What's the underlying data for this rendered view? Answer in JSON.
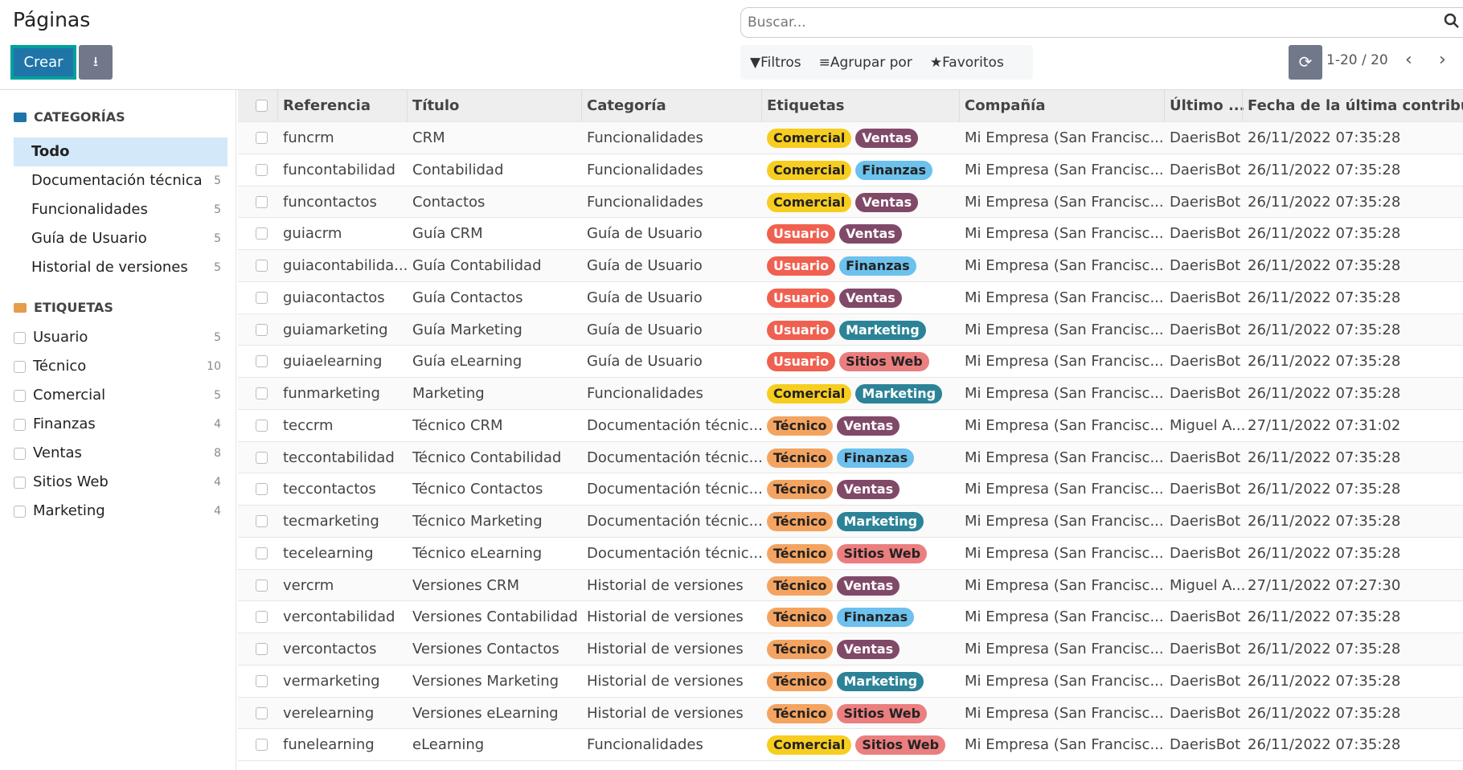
{
  "title": "Páginas",
  "search": {
    "placeholder": "Buscar..."
  },
  "toolbar": {
    "create_label": "Crear",
    "filters": "Filtros",
    "group_by": "Agrupar por",
    "favorites": "Favoritos",
    "pager": "1-20 / 20"
  },
  "sidebar": {
    "categories_title": "CATEGORÍAS",
    "categories": [
      {
        "label": "Todo",
        "count": null
      },
      {
        "label": "Documentación técnica",
        "count": "5"
      },
      {
        "label": "Funcionalidades",
        "count": "5"
      },
      {
        "label": "Guía de Usuario",
        "count": "5"
      },
      {
        "label": "Historial de versiones",
        "count": "5"
      }
    ],
    "tags_title": "ETIQUETAS",
    "tags": [
      {
        "label": "Usuario",
        "count": "5"
      },
      {
        "label": "Técnico",
        "count": "10"
      },
      {
        "label": "Comercial",
        "count": "5"
      },
      {
        "label": "Finanzas",
        "count": "4"
      },
      {
        "label": "Ventas",
        "count": "8"
      },
      {
        "label": "Sitios Web",
        "count": "4"
      },
      {
        "label": "Marketing",
        "count": "4"
      }
    ]
  },
  "colors": {
    "Comercial": [
      "#f7cd1f",
      "#222"
    ],
    "Ventas": [
      "#814968",
      "#fff"
    ],
    "Finanzas": [
      "#6cc1ed",
      "#222"
    ],
    "Usuario": [
      "#f06050",
      "#fff"
    ],
    "Técnico": [
      "#f4a460",
      "#222"
    ],
    "Marketing": [
      "#2c8397",
      "#fff"
    ],
    "Sitios Web": [
      "#eb7e7f",
      "#222"
    ],
    "categories_folder": "#1f75a8",
    "tags_folder": "#e59d4c"
  },
  "table": {
    "columns": [
      "Referencia",
      "Título",
      "Categoría",
      "Etiquetas",
      "Compañía",
      "Último ...",
      "Fecha de la última contribución"
    ],
    "rows": [
      [
        "funcrm",
        "CRM",
        "Funcionalidades",
        [
          "Comercial",
          "Ventas"
        ],
        "Mi Empresa (San Francisc...",
        "DaerisBot",
        "26/11/2022 07:35:28"
      ],
      [
        "funcontabilidad",
        "Contabilidad",
        "Funcionalidades",
        [
          "Comercial",
          "Finanzas"
        ],
        "Mi Empresa (San Francisc...",
        "DaerisBot",
        "26/11/2022 07:35:28"
      ],
      [
        "funcontactos",
        "Contactos",
        "Funcionalidades",
        [
          "Comercial",
          "Ventas"
        ],
        "Mi Empresa (San Francisc...",
        "DaerisBot",
        "26/11/2022 07:35:28"
      ],
      [
        "guiacrm",
        "Guía CRM",
        "Guía de Usuario",
        [
          "Usuario",
          "Ventas"
        ],
        "Mi Empresa (San Francisc...",
        "DaerisBot",
        "26/11/2022 07:35:28"
      ],
      [
        "guiacontabilida...",
        "Guía Contabilidad",
        "Guía de Usuario",
        [
          "Usuario",
          "Finanzas"
        ],
        "Mi Empresa (San Francisc...",
        "DaerisBot",
        "26/11/2022 07:35:28"
      ],
      [
        "guiacontactos",
        "Guía Contactos",
        "Guía de Usuario",
        [
          "Usuario",
          "Ventas"
        ],
        "Mi Empresa (San Francisc...",
        "DaerisBot",
        "26/11/2022 07:35:28"
      ],
      [
        "guiamarketing",
        "Guía Marketing",
        "Guía de Usuario",
        [
          "Usuario",
          "Marketing"
        ],
        "Mi Empresa (San Francisc...",
        "DaerisBot",
        "26/11/2022 07:35:28"
      ],
      [
        "guiaelearning",
        "Guía eLearning",
        "Guía de Usuario",
        [
          "Usuario",
          "Sitios Web"
        ],
        "Mi Empresa (San Francisc...",
        "DaerisBot",
        "26/11/2022 07:35:28"
      ],
      [
        "funmarketing",
        "Marketing",
        "Funcionalidades",
        [
          "Comercial",
          "Marketing"
        ],
        "Mi Empresa (San Francisc...",
        "DaerisBot",
        "26/11/2022 07:35:28"
      ],
      [
        "teccrm",
        "Técnico CRM",
        "Documentación técnic...",
        [
          "Técnico",
          "Ventas"
        ],
        "Mi Empresa (San Francisc...",
        "Miguel A...",
        "27/11/2022 07:31:02"
      ],
      [
        "teccontabilidad",
        "Técnico Contabilidad",
        "Documentación técnic...",
        [
          "Técnico",
          "Finanzas"
        ],
        "Mi Empresa (San Francisc...",
        "DaerisBot",
        "26/11/2022 07:35:28"
      ],
      [
        "teccontactos",
        "Técnico Contactos",
        "Documentación técnic...",
        [
          "Técnico",
          "Ventas"
        ],
        "Mi Empresa (San Francisc...",
        "DaerisBot",
        "26/11/2022 07:35:28"
      ],
      [
        "tecmarketing",
        "Técnico Marketing",
        "Documentación técnic...",
        [
          "Técnico",
          "Marketing"
        ],
        "Mi Empresa (San Francisc...",
        "DaerisBot",
        "26/11/2022 07:35:28"
      ],
      [
        "tecelearning",
        "Técnico eLearning",
        "Documentación técnic...",
        [
          "Técnico",
          "Sitios Web"
        ],
        "Mi Empresa (San Francisc...",
        "DaerisBot",
        "26/11/2022 07:35:28"
      ],
      [
        "vercrm",
        "Versiones CRM",
        "Historial de versiones",
        [
          "Técnico",
          "Ventas"
        ],
        "Mi Empresa (San Francisc...",
        "Miguel A...",
        "27/11/2022 07:27:30"
      ],
      [
        "vercontabilidad",
        "Versiones Contabilidad",
        "Historial de versiones",
        [
          "Técnico",
          "Finanzas"
        ],
        "Mi Empresa (San Francisc...",
        "DaerisBot",
        "26/11/2022 07:35:28"
      ],
      [
        "vercontactos",
        "Versiones Contactos",
        "Historial de versiones",
        [
          "Técnico",
          "Ventas"
        ],
        "Mi Empresa (San Francisc...",
        "DaerisBot",
        "26/11/2022 07:35:28"
      ],
      [
        "vermarketing",
        "Versiones Marketing",
        "Historial de versiones",
        [
          "Técnico",
          "Marketing"
        ],
        "Mi Empresa (San Francisc...",
        "DaerisBot",
        "26/11/2022 07:35:28"
      ],
      [
        "verelearning",
        "Versiones eLearning",
        "Historial de versiones",
        [
          "Técnico",
          "Sitios Web"
        ],
        "Mi Empresa (San Francisc...",
        "DaerisBot",
        "26/11/2022 07:35:28"
      ],
      [
        "funelearning",
        "eLearning",
        "Funcionalidades",
        [
          "Comercial",
          "Sitios Web"
        ],
        "Mi Empresa (San Francisc...",
        "DaerisBot",
        "26/11/2022 07:35:28"
      ]
    ]
  }
}
